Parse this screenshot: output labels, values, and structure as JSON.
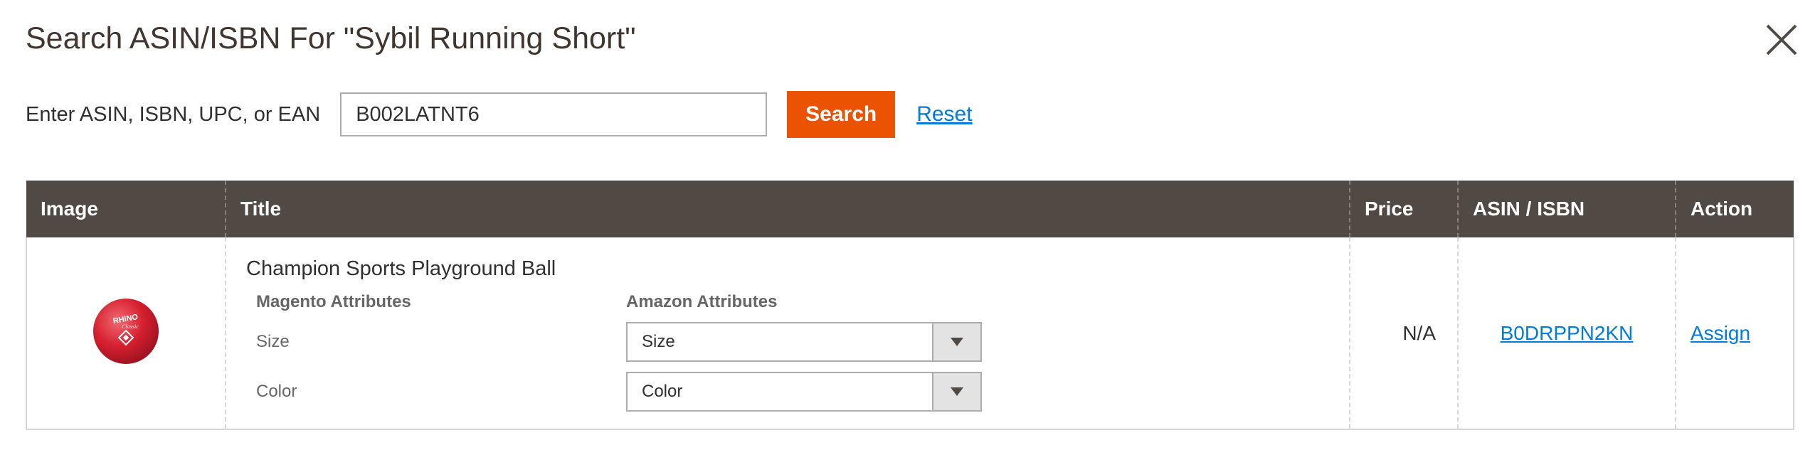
{
  "modal": {
    "title": "Search ASIN/ISBN For \"Sybil Running Short\""
  },
  "search": {
    "label": "Enter ASIN, ISBN, UPC, or EAN",
    "value": "B002LATNT6",
    "button_label": "Search",
    "reset_label": "Reset"
  },
  "table": {
    "columns": [
      "Image",
      "Title",
      "Price",
      "ASIN / ISBN",
      "Action"
    ],
    "rows": [
      {
        "image_icon": "red-playground-ball-image",
        "title": "Champion Sports Playground Ball",
        "magento_attributes_header": "Magento Attributes",
        "amazon_attributes_header": "Amazon Attributes",
        "attributes": [
          {
            "label": "Size",
            "selected": "Size"
          },
          {
            "label": "Color",
            "selected": "Color"
          }
        ],
        "price": "N/A",
        "asin": "B0DRPPN2KN",
        "action": "Assign"
      }
    ]
  },
  "colors": {
    "header_bg": "#514943",
    "search_button": "#eb5202",
    "link": "#007bdb"
  }
}
